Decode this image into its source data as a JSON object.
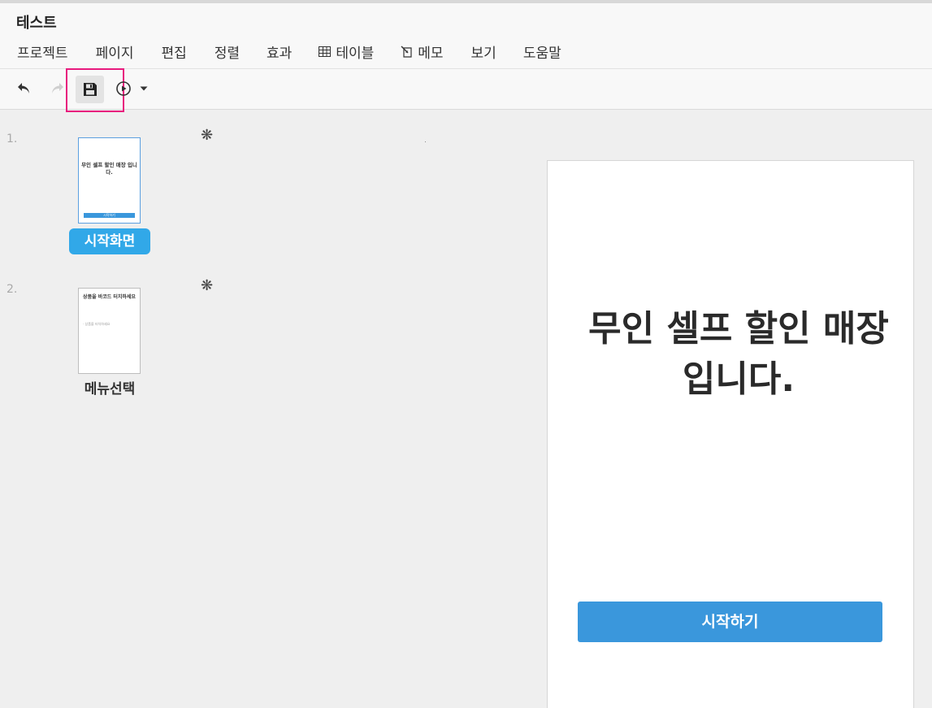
{
  "app": {
    "title": "테스트"
  },
  "menu": {
    "items": [
      {
        "label": "프로젝트",
        "icon": null
      },
      {
        "label": "페이지",
        "icon": null
      },
      {
        "label": "편집",
        "icon": null
      },
      {
        "label": "정렬",
        "icon": null
      },
      {
        "label": "효과",
        "icon": null
      },
      {
        "label": "테이블",
        "icon": "table-icon"
      },
      {
        "label": "메모",
        "icon": "memo-icon"
      },
      {
        "label": "보기",
        "icon": null
      },
      {
        "label": "도움말",
        "icon": null
      }
    ]
  },
  "toolbar": {
    "undo_icon": "undo-icon",
    "redo_icon": "redo-icon",
    "save_icon": "save-icon",
    "play_icon": "play-circle-icon",
    "dropdown_icon": "caret-down-icon",
    "highlight_color": "#e8197d"
  },
  "slides": [
    {
      "number": "1.",
      "name": "시작화면",
      "marker": "❋",
      "thumb_title": "무인 셀프 할인 매장 입니다.",
      "thumb_button": "시작하기",
      "selected": true
    },
    {
      "number": "2.",
      "name": "메뉴선택",
      "marker": "❋",
      "thumb_title": "상품을 바코드 터치하세요",
      "thumb_small": "· 상품을 터치하세요",
      "selected": false
    }
  ],
  "preview": {
    "title_line1": "무인 셀프 할인 매장",
    "title_line2": "입니다.",
    "button_label": "시작하기"
  },
  "colors": {
    "accent": "#31a8e8",
    "button": "#3a97dc",
    "background": "#efefef"
  }
}
